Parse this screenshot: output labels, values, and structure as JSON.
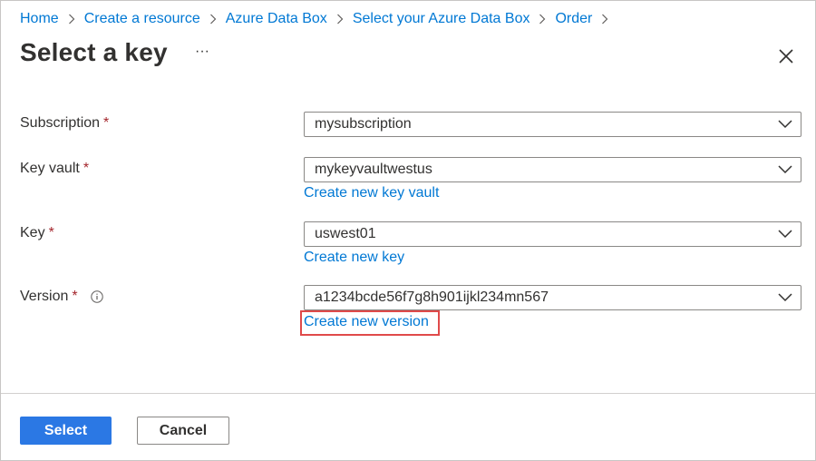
{
  "breadcrumb": [
    "Home",
    "Create a resource",
    "Azure Data Box",
    "Select your Azure Data Box",
    "Order"
  ],
  "title": "Select a key",
  "more_label": "···",
  "required_marker": "*",
  "fields": {
    "subscription": {
      "label": "Subscription",
      "value": "mysubscription"
    },
    "key_vault": {
      "label": "Key vault",
      "value": "mykeyvaultwestus",
      "link": "Create new key vault"
    },
    "key": {
      "label": "Key",
      "value": "uswest01",
      "link": "Create new key"
    },
    "version": {
      "label": "Version",
      "value": "a1234bcde56f7g8h901ijkl234mn567",
      "link": "Create new version"
    }
  },
  "buttons": {
    "select": "Select",
    "cancel": "Cancel"
  },
  "colors": {
    "link": "#0078d4",
    "primary": "#2b78e4",
    "required": "#a4262c",
    "highlight": "#e04a4a"
  },
  "icons": [
    "chevron-right-icon",
    "more-icon",
    "close-icon",
    "chevron-down-icon",
    "info-icon"
  ]
}
